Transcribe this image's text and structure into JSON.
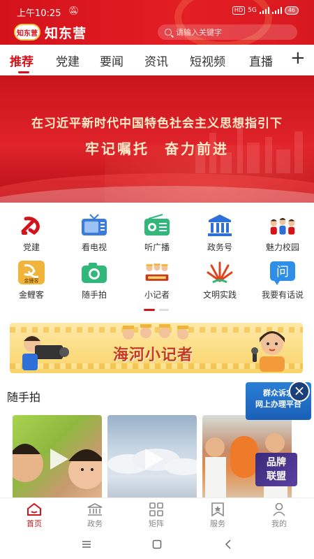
{
  "status_bar": {
    "time": "上午10:25",
    "hd": "HD",
    "net": "5G",
    "battery": "46"
  },
  "header": {
    "logo_mark": "知东营",
    "app_name": "知东营",
    "search_placeholder": "请输入关键字"
  },
  "tabs": [
    {
      "label": "推荐",
      "active": true
    },
    {
      "label": "党建"
    },
    {
      "label": "要闻"
    },
    {
      "label": "资讯"
    },
    {
      "label": "短视频"
    },
    {
      "label": "直播"
    }
  ],
  "banner": {
    "line1": "在习近平新时代中国特色社会主义思想指引下",
    "line2": "牢记嘱托 奋力前进"
  },
  "grid": [
    {
      "label": "党建",
      "icon": "party-emblem-icon"
    },
    {
      "label": "看电视",
      "icon": "tv-icon"
    },
    {
      "label": "听广播",
      "icon": "radio-icon"
    },
    {
      "label": "政务号",
      "icon": "government-building-icon"
    },
    {
      "label": "魅力校园",
      "icon": "campus-kids-icon"
    },
    {
      "label": "金鲤客",
      "icon": "golden-carp-icon"
    },
    {
      "label": "随手拍",
      "icon": "camera-icon"
    },
    {
      "label": "小记者",
      "icon": "little-reporter-icon"
    },
    {
      "label": "文明实践",
      "icon": "civilization-practice-icon"
    },
    {
      "label": "我要有话说",
      "icon": "speak-up-icon"
    }
  ],
  "grid_icon_text": {
    "golden_carp_caption": "金鲤客",
    "speak_up_glyph": "问"
  },
  "reporter_banner": {
    "title": "海河小记者"
  },
  "section": {
    "title": "随手拍"
  },
  "float_ad": {
    "line1": "群众诉求",
    "line2": "网上办理平台"
  },
  "brand_badge": {
    "line1": "品牌",
    "line2": "联盟"
  },
  "bottom_nav": [
    {
      "label": "首页",
      "icon": "home-icon",
      "active": true
    },
    {
      "label": "政务",
      "icon": "government-icon"
    },
    {
      "label": "矩阵",
      "icon": "matrix-grid-icon"
    },
    {
      "label": "服务",
      "icon": "service-star-icon"
    },
    {
      "label": "我的",
      "icon": "profile-icon"
    }
  ],
  "colors": {
    "brand_red": "#d4121a",
    "tab_active": "#d4121a",
    "text": "#333333"
  }
}
